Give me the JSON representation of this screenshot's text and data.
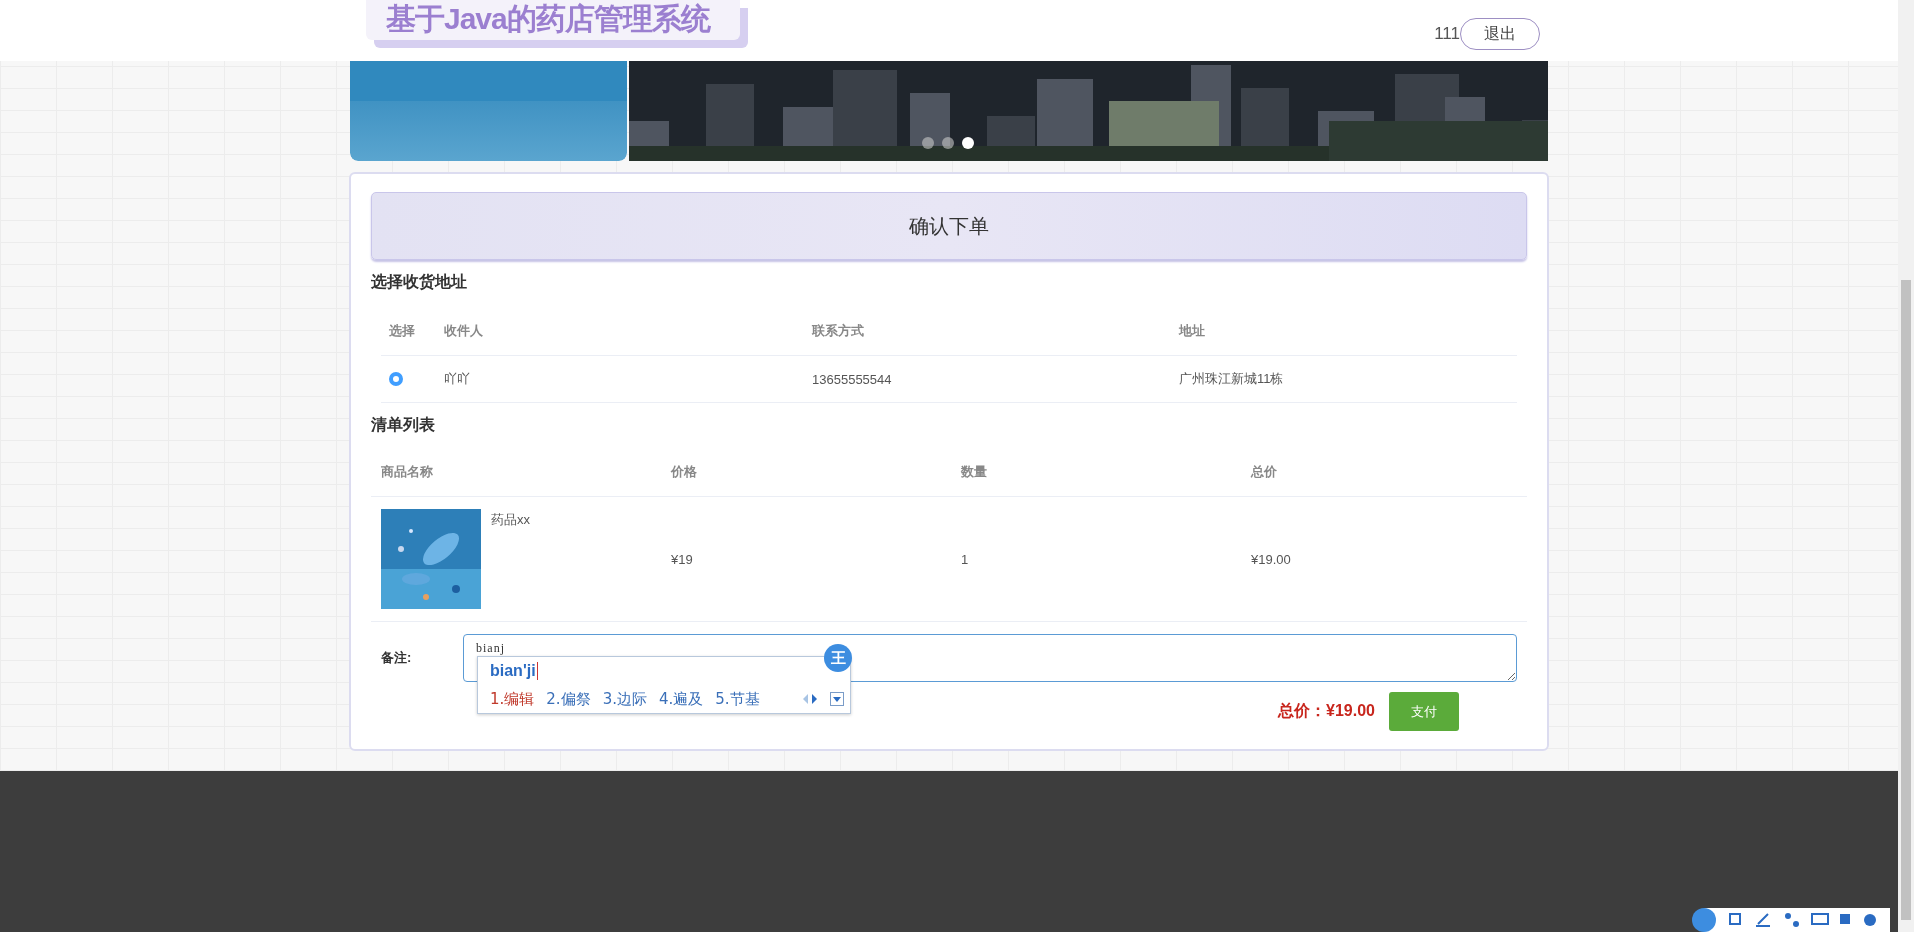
{
  "header": {
    "title": "基于Java的药店管理系统",
    "username": "111",
    "logout": "退出"
  },
  "banner": {
    "slides": [
      {
        "selected": false
      },
      {
        "selected": false
      },
      {
        "selected": true
      }
    ]
  },
  "order": {
    "title": "确认下单",
    "address_section": "选择收货地址",
    "address_columns": [
      "选择",
      "收件人",
      "联系方式",
      "地址"
    ],
    "addresses": [
      {
        "selected": true,
        "name": "吖吖",
        "phone": "13655555544",
        "address": "广州珠江新城11栋"
      }
    ],
    "list_section": "清单列表",
    "item_columns": [
      "商品名称",
      "价格",
      "数量",
      "总价"
    ],
    "items": [
      {
        "name": "药品xx",
        "price": "¥19",
        "quantity": "1",
        "total": "¥19.00"
      }
    ],
    "remark_label": "备注:",
    "remark_value": "bianj",
    "total": "总价：¥19.00",
    "pay": "支付"
  },
  "ime": {
    "composition": "bian'ji",
    "logo": "王",
    "candidates": [
      {
        "text": "1.编辑",
        "selected": true
      },
      {
        "text": "2.偏祭",
        "selected": false
      },
      {
        "text": "3.边际",
        "selected": false
      },
      {
        "text": "4.遍及",
        "selected": false
      },
      {
        "text": "5.节基",
        "selected": false
      }
    ]
  }
}
